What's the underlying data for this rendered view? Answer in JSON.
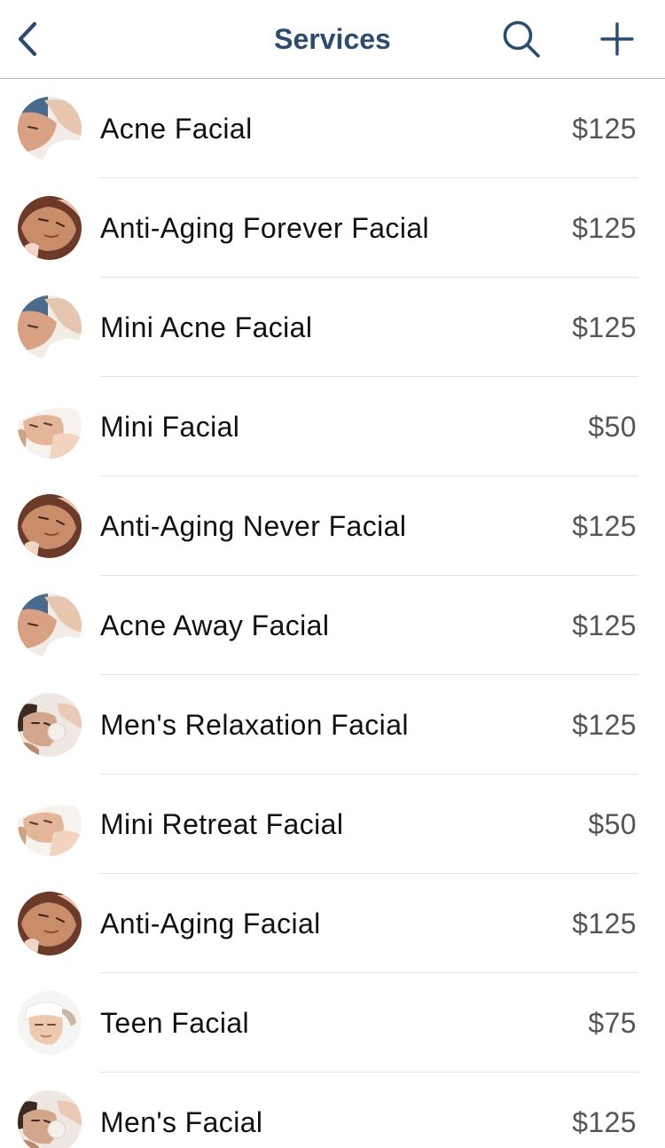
{
  "header": {
    "title": "Services",
    "back_icon": "chevron-left-icon",
    "search_icon": "search-icon",
    "add_icon": "plus-icon",
    "accent_color": "#2d4b6e"
  },
  "services": [
    {
      "name": "Acne Facial",
      "price": "$125",
      "thumbnail": "acne-facial-photo"
    },
    {
      "name": "Anti-Aging Forever Facial",
      "price": "$125",
      "thumbnail": "anti-aging-facial-photo"
    },
    {
      "name": "Mini Acne Facial",
      "price": "$125",
      "thumbnail": "acne-facial-photo"
    },
    {
      "name": "Mini Facial",
      "price": "$50",
      "thumbnail": "mini-facial-photo"
    },
    {
      "name": "Anti-Aging Never Facial",
      "price": "$125",
      "thumbnail": "anti-aging-facial-photo"
    },
    {
      "name": "Acne Away Facial",
      "price": "$125",
      "thumbnail": "acne-facial-photo"
    },
    {
      "name": "Men's Relaxation Facial",
      "price": "$125",
      "thumbnail": "mens-facial-photo"
    },
    {
      "name": "Mini Retreat Facial",
      "price": "$50",
      "thumbnail": "mini-facial-photo"
    },
    {
      "name": "Anti-Aging Facial",
      "price": "$125",
      "thumbnail": "anti-aging-facial-photo"
    },
    {
      "name": "Teen Facial",
      "price": "$75",
      "thumbnail": "teen-facial-photo"
    },
    {
      "name": "Men's Facial",
      "price": "$125",
      "thumbnail": "mens-facial-photo"
    }
  ]
}
